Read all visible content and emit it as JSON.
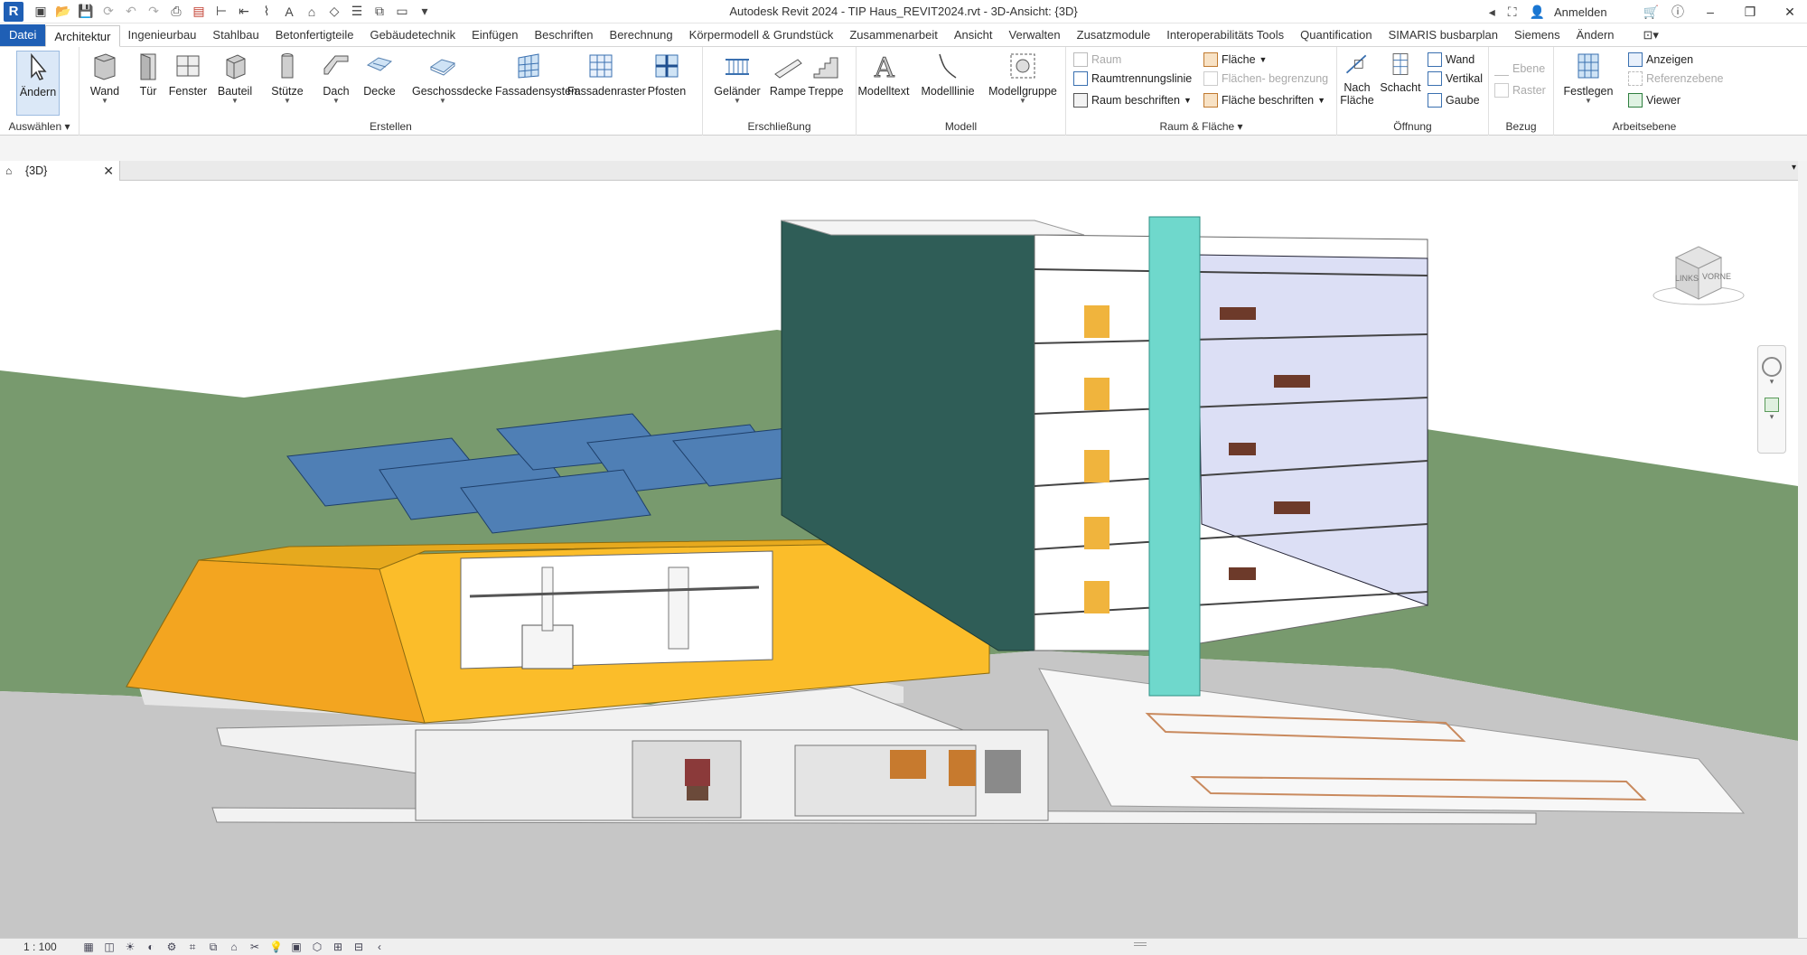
{
  "title_bar": {
    "logo": "R",
    "window_title": "Autodesk Revit 2024 - TIP Haus_REVIT2024.rvt - 3D-Ansicht: {3D}",
    "sign_in": "Anmelden"
  },
  "ribbon_tabs": [
    "Datei",
    "Architektur",
    "Ingenieurbau",
    "Stahlbau",
    "Betonfertigteile",
    "Gebäudetechnik",
    "Einfügen",
    "Beschriften",
    "Berechnung",
    "Körpermodell & Grundstück",
    "Zusammenarbeit",
    "Ansicht",
    "Verwalten",
    "Zusatzmodule",
    "Interoperabilitäts Tools",
    "Quantification",
    "SIMARIS busbarplan",
    "Siemens",
    "Ändern"
  ],
  "active_tab": "Architektur",
  "panels": {
    "select": {
      "label": "Auswählen",
      "modify": "Ändern"
    },
    "build": {
      "label": "Erstellen",
      "wall": "Wand",
      "door": "Tür",
      "window": "Fenster",
      "component": "Bauteil",
      "column": "Stütze",
      "roof": "Dach",
      "ceiling": "Decke",
      "floor": "Geschossdecke",
      "curtain_system": "Fassadensystem",
      "curtain_grid": "Fassadenraster",
      "mullion": "Pfosten"
    },
    "circulation": {
      "label": "Erschließung",
      "railing": "Geländer",
      "ramp": "Rampe",
      "stair": "Treppe"
    },
    "model": {
      "label": "Modell",
      "model_text": "Modelltext",
      "model_line": "Modelllinie",
      "model_group": "Modellgruppe"
    },
    "room_area": {
      "label": "Raum & Fläche",
      "room": "Raum",
      "room_separator": "Raumtrennungslinie",
      "tag_room": "Raum  beschriften",
      "area": "Fläche",
      "area_boundary": "Flächen- begrenzung",
      "tag_area": "Fläche  beschriften"
    },
    "opening": {
      "label": "Öffnung",
      "by_face_1": "Nach",
      "by_face_2": "Fläche",
      "shaft": "Schacht",
      "wall": "Wand",
      "vertical": "Vertikal",
      "dormer": "Gaube"
    },
    "datum": {
      "label": "Bezug",
      "level": "Ebene",
      "grid": "Raster"
    },
    "work_plane": {
      "label": "Arbeitsebene",
      "set": "Festlegen",
      "show": "Anzeigen",
      "ref_plane": "Referenzebene",
      "viewer": "Viewer"
    }
  },
  "view_tab": {
    "label": "{3D}"
  },
  "viewcube": {
    "left_face": "LINKS",
    "front_face": "VORNE"
  },
  "status_bar": {
    "scale": "1 : 100"
  },
  "colors": {
    "accent": "#1f5fb5",
    "yellow_building": "#fbbd2a",
    "teal_wall": "#2f5d57",
    "cyan_shaft": "#6fd8cc",
    "ground": "#789a6e",
    "sky": "#ffffff"
  }
}
